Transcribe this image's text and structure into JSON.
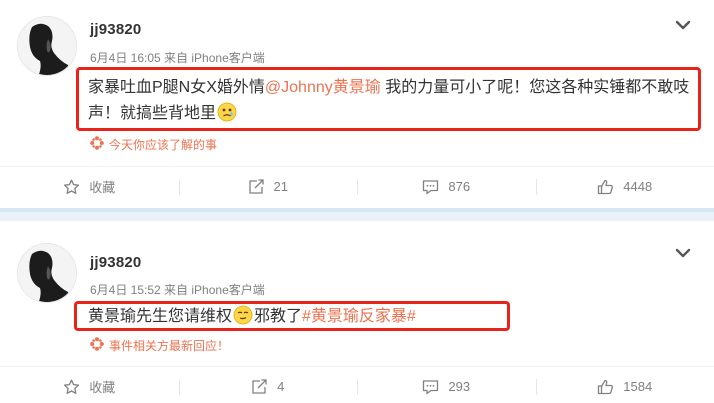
{
  "posts": [
    {
      "username": "jj93820",
      "meta": "6月4日 16:05 来自 iPhone客户端",
      "content": {
        "text1": "家暴吐血P腿N女X婚外情",
        "mention": "@Johnny黄景瑜",
        "text2": " 我的力量可小了呢！您这各种实锤都不敢吱声！就搞些背地里"
      },
      "notice": "今天你应该了解的事",
      "actions": {
        "favorite": "收藏",
        "repost": "21",
        "comment": "876",
        "like": "4448"
      }
    },
    {
      "username": "jj93820",
      "meta": "6月4日 15:52 来自 iPhone客户端",
      "content": {
        "text1": "黄景瑜先生您请维权",
        "text2": "邪教了",
        "hashtag": "#黄景瑜反家暴#"
      },
      "notice": "事件相关方最新回应！",
      "actions": {
        "favorite": "收藏",
        "repost": "4",
        "comment": "293",
        "like": "1584"
      }
    }
  ],
  "colors": {
    "accent": "#eb7350",
    "highlight": "#e8231a",
    "muted": "#808080",
    "band": "#eaf1f8"
  },
  "icons": [
    "avatar",
    "chevron-down-icon",
    "emoji-icon",
    "notice-icon",
    "star-icon",
    "repost-icon",
    "comment-icon",
    "like-icon"
  ]
}
